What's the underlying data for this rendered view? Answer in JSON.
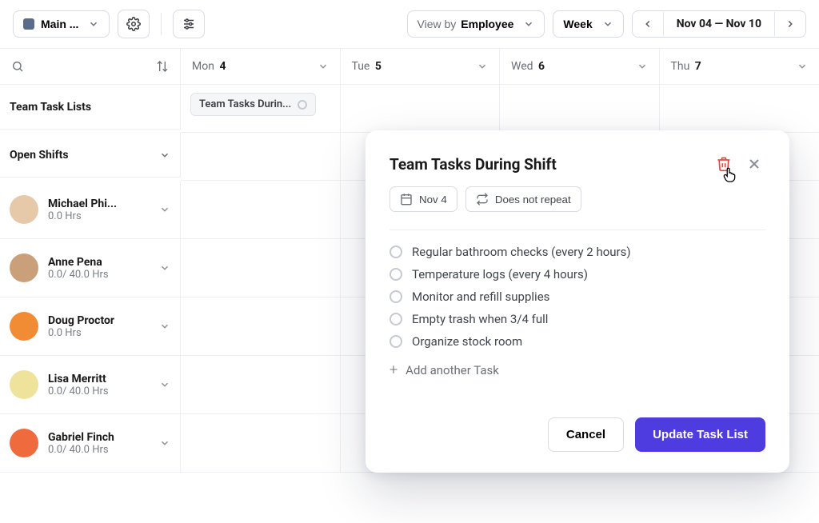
{
  "toolbar": {
    "location_label": "Main ...",
    "viewby_label": "View by",
    "viewby_value": "Employee",
    "period_value": "Week",
    "date_range": "Nov 04 — Nov 10"
  },
  "columns": {
    "days": [
      {
        "dow": "Mon",
        "num": "4"
      },
      {
        "dow": "Tue",
        "num": "5"
      },
      {
        "dow": "Wed",
        "num": "6"
      },
      {
        "dow": "Thu",
        "num": "7"
      }
    ]
  },
  "sidebar": {
    "team_task_lists_label": "Team Task Lists",
    "open_shifts_label": "Open Shifts"
  },
  "task_chip_label": "Team Tasks Durin...",
  "employees": [
    {
      "name": "Michael Phi...",
      "sub": "0.0 Hrs"
    },
    {
      "name": "Anne Pena",
      "sub": "0.0/ 40.0 Hrs"
    },
    {
      "name": "Doug Proctor",
      "sub": "0.0 Hrs"
    },
    {
      "name": "Lisa Merritt",
      "sub": "0.0/ 40.0 Hrs"
    },
    {
      "name": "Gabriel Finch",
      "sub": "0.0/ 40.0 Hrs"
    }
  ],
  "popover": {
    "title": "Team Tasks During Shift",
    "date_label": "Nov 4",
    "repeat_label": "Does not repeat",
    "tasks": [
      "Regular bathroom checks (every 2 hours)",
      "Temperature logs (every 4 hours)",
      "Monitor and refill supplies",
      "Empty trash when 3/4 full",
      "Organize stock room"
    ],
    "add_task_label": "Add another Task",
    "cancel_label": "Cancel",
    "submit_label": "Update Task List"
  }
}
